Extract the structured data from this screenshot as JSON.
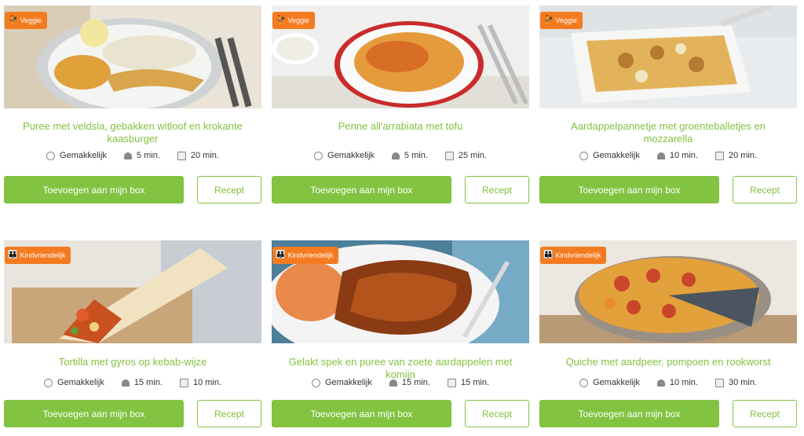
{
  "recipes": [
    {
      "badge": "Veggie",
      "badge_icon": "chicken-veggie-icon",
      "title": "Puree met veldsla, gebakken witloof en krokante kaasburger",
      "difficulty": "Gemakkelijk",
      "prep": "5 min.",
      "cook": "20 min.",
      "add_label": "Toevoegen aan mijn box",
      "recipe_label": "Recept"
    },
    {
      "badge": "Veggie",
      "badge_icon": "chicken-veggie-icon",
      "title": "Penne all'arrabiata met tofu",
      "difficulty": "Gemakkelijk",
      "prep": "5 min.",
      "cook": "25 min.",
      "add_label": "Toevoegen aan mijn box",
      "recipe_label": "Recept"
    },
    {
      "badge": "Veggie",
      "badge_icon": "chicken-veggie-icon",
      "title": "Aardappelpannetje met groenteballetjes en mozzarella",
      "difficulty": "Gemakkelijk",
      "prep": "10 min.",
      "cook": "20 min.",
      "add_label": "Toevoegen aan mijn box",
      "recipe_label": "Recept"
    },
    {
      "badge": "Kindvriendelijk",
      "badge_icon": "family-icon",
      "title": "Tortilla met gyros op kebab-wijze",
      "difficulty": "Gemakkelijk",
      "prep": "15 min.",
      "cook": "10 min.",
      "add_label": "Toevoegen aan mijn box",
      "recipe_label": "Recept"
    },
    {
      "badge": "Kindvriendelijk",
      "badge_icon": "family-icon",
      "title": "Gelakt spek en puree van zoete aardappelen met komijn",
      "difficulty": "Gemakkelijk",
      "prep": "15 min.",
      "cook": "15 min.",
      "add_label": "Toevoegen aan mijn box",
      "recipe_label": "Recept"
    },
    {
      "badge": "Kindvriendelijk",
      "badge_icon": "family-icon",
      "title": "Quiche met aardpeer, pompoen en rookworst",
      "difficulty": "Gemakkelijk",
      "prep": "10 min.",
      "cook": "30 min.",
      "add_label": "Toevoegen aan mijn box",
      "recipe_label": "Recept"
    }
  ],
  "colors": {
    "accent_green": "#82c341",
    "badge_orange": "#f47b20"
  },
  "icons": {
    "difficulty": "chef-face-icon",
    "prep": "chef-hat-icon",
    "cook": "pan-icon"
  }
}
